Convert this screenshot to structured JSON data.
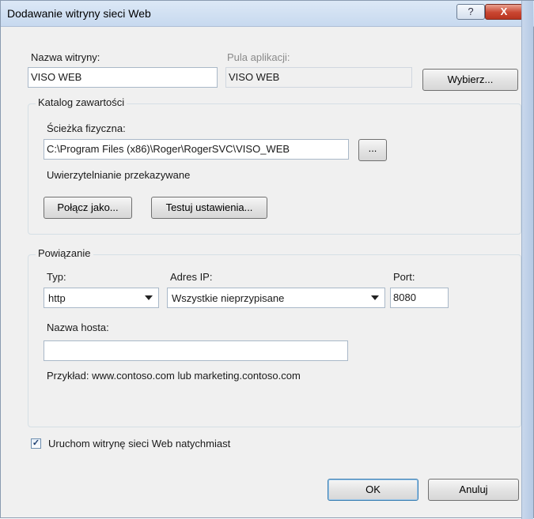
{
  "window": {
    "title": "Dodawanie witryny sieci Web",
    "help_glyph": "?",
    "close_glyph": "X"
  },
  "site": {
    "name_label": "Nazwa witryny:",
    "name_value": "VISO WEB",
    "pool_label": "Pula aplikacji:",
    "pool_value": "VISO WEB",
    "choose_button": "Wybierz..."
  },
  "content": {
    "group_title": "Katalog zawartości",
    "path_label": "Ścieżka fizyczna:",
    "path_value": "C:\\Program Files (x86)\\Roger\\RogerSVC\\VISO_WEB",
    "browse_button": "...",
    "auth_text": "Uwierzytelnianie przekazywane",
    "connect_button": "Połącz jako...",
    "test_button": "Testuj ustawienia..."
  },
  "binding": {
    "group_title": "Powiązanie",
    "type_label": "Typ:",
    "type_value": "http",
    "ip_label": "Adres IP:",
    "ip_value": "Wszystkie nieprzypisane",
    "port_label": "Port:",
    "port_value": "8080",
    "host_label": "Nazwa hosta:",
    "host_value": "",
    "example_text": "Przykład: www.contoso.com lub marketing.contoso.com"
  },
  "start": {
    "label": "Uruchom witrynę sieci Web natychmiast",
    "checked": true,
    "check_glyph": "✓"
  },
  "footer": {
    "ok": "OK",
    "cancel": "Anuluj"
  }
}
